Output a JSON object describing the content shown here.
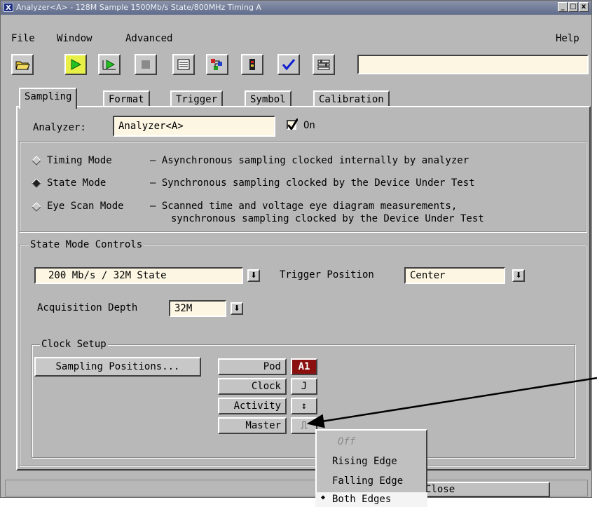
{
  "window": {
    "title": "Analyzer<A> - 128M Sample 1500Mb/s State/800MHz Timing A",
    "controls": [
      "_",
      "□",
      "x"
    ]
  },
  "menubar": {
    "file": "File",
    "window": "Window",
    "advanced": "Advanced",
    "help": "Help"
  },
  "toolbar": {
    "buttons": [
      "open-folder-icon",
      "run-icon",
      "run-repetitive-icon",
      "stop-icon",
      "list-icon",
      "waveform-icon",
      "probe-icon",
      "checkmark-icon",
      "setup-icon"
    ],
    "accent_color": "#e8f048"
  },
  "tabs": [
    "Sampling",
    "Format",
    "Trigger",
    "Symbol",
    "Calibration"
  ],
  "analyzer": {
    "label": "Analyzer:",
    "value": "Analyzer<A>",
    "on_label": "On",
    "on_checked": true
  },
  "modes": [
    {
      "name": "Timing Mode",
      "desc": "– Asynchronous sampling clocked internally by analyzer",
      "selected": false
    },
    {
      "name": "State Mode",
      "desc": "– Synchronous sampling clocked by the Device Under Test",
      "selected": true
    },
    {
      "name": "Eye Scan Mode",
      "desc": "– Scanned time and voltage eye diagram measurements,",
      "desc2": "synchronous sampling clocked by the Device Under Test",
      "selected": false
    }
  ],
  "state_controls": {
    "title": "State Mode Controls",
    "rate_value": "200 Mb/s /  32M State",
    "trigger_label": "Trigger Position",
    "trigger_value": "Center",
    "depth_label": "Acquisition Depth",
    "depth_value": "32M"
  },
  "clock_setup": {
    "title": "Clock Setup",
    "sampling_button": "Sampling Positions...",
    "rows": [
      {
        "label": "Pod",
        "value": "A1"
      },
      {
        "label": "Clock",
        "value": "J"
      },
      {
        "label": "Activity",
        "value": "↕"
      },
      {
        "label": "Master",
        "value": "⎍"
      }
    ],
    "pod_color": "#8b1010"
  },
  "popup_menu": {
    "items": [
      "Off",
      "Rising Edge",
      "Falling Edge",
      "Both Edges"
    ],
    "selected": "Both Edges",
    "disabled": "Off"
  },
  "footer": {
    "close_label": "Close"
  }
}
